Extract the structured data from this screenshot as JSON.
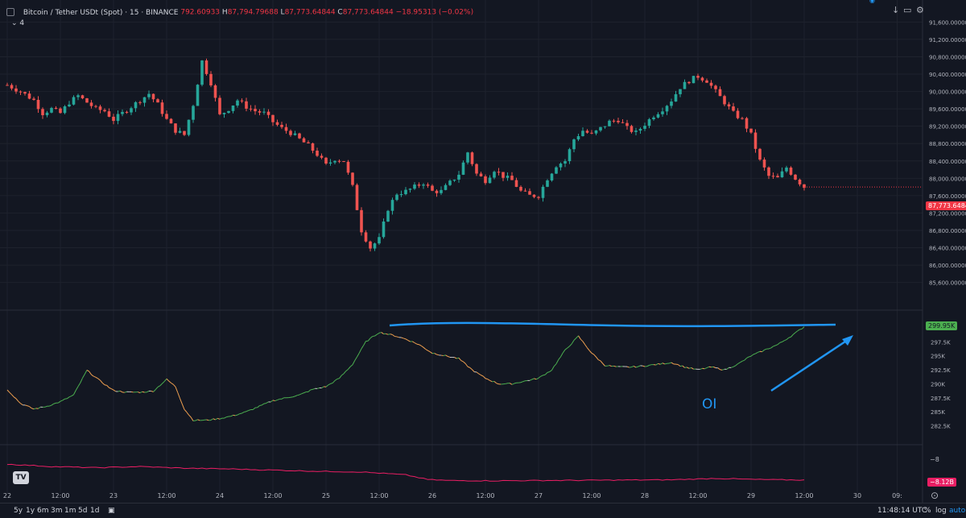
{
  "header": {
    "title": "Bitcoin / Tether USDt (Spot) · 15 · BINANCE",
    "o_value": "792.60933",
    "h_label": "H",
    "h_value": "87,794.79688",
    "l_label": "L",
    "l_value": "87,773.64844",
    "c_label": "C",
    "c_value": "87,773.64844",
    "change": "−18.95313 (−0.02%)",
    "sub_value": "4"
  },
  "price_badge": "87,773.64844",
  "oi_badge": "299.95K",
  "lower_badge": "−8.12B",
  "lower_tick": "−8",
  "annotation": "OI",
  "timeframes": [
    "5y",
    "1y",
    "6m",
    "3m",
    "1m",
    "5d",
    "1d"
  ],
  "bottom_right": {
    "time": "11:48:14 UTC",
    "percent": "%",
    "log": "log",
    "auto": "auto"
  },
  "chart_data": [
    {
      "type": "candlestick",
      "title": "Bitcoin / Tether USDt (Spot) · 15 · BINANCE",
      "ylim": [
        85500,
        91700
      ],
      "y_ticks": [
        "91,600.000000",
        "91,200.000000",
        "90,800.000000",
        "90,400.000000",
        "90,000.000000",
        "89,600.000000",
        "89,200.000000",
        "88,800.000000",
        "88,400.000000",
        "88,000.000000",
        "87,600.000000",
        "87,200.000000",
        "86,800.000000",
        "86,400.000000",
        "86,000.000000",
        "85,600.000000"
      ],
      "y_tick_values": [
        91600,
        91200,
        90800,
        90400,
        90000,
        89600,
        89200,
        88800,
        88400,
        88000,
        87600,
        87200,
        86800,
        86400,
        86000,
        85600
      ],
      "x_ticks": [
        "22",
        "12:00",
        "23",
        "12:00",
        "24",
        "12:00",
        "25",
        "12:00",
        "26",
        "12:00",
        "27",
        "12:00",
        "28",
        "12:00",
        "29",
        "12:00",
        "30",
        "09:"
      ],
      "x_tick_hours": [
        0,
        12,
        24,
        36,
        48,
        60,
        72,
        84,
        96,
        108,
        120,
        132,
        144,
        156,
        168,
        180,
        192,
        201
      ],
      "path_hours": [
        0,
        3,
        6,
        8,
        10,
        12,
        14,
        16,
        18,
        20,
        22,
        24,
        26,
        28,
        30,
        32,
        34,
        36,
        38,
        40,
        42,
        44,
        46,
        48,
        50,
        52,
        54,
        56,
        58,
        60,
        62,
        64,
        66,
        68,
        70,
        72,
        74,
        76,
        78,
        80,
        82,
        84,
        86,
        88,
        90,
        92,
        94,
        96,
        98,
        100,
        102,
        104,
        106,
        108,
        110,
        112,
        114,
        116,
        118,
        120,
        122,
        124,
        126,
        128,
        130,
        132,
        134,
        136,
        138,
        140,
        142,
        144,
        146,
        148,
        150,
        152,
        154,
        156,
        158,
        160,
        162,
        164,
        166,
        168,
        170,
        172,
        174,
        176,
        178,
        180
      ],
      "path_prices": [
        90150,
        90000,
        89800,
        89500,
        89600,
        89500,
        89750,
        89900,
        89750,
        89600,
        89550,
        89350,
        89500,
        89650,
        89800,
        89950,
        89700,
        89350,
        89100,
        89000,
        89700,
        90700,
        90200,
        89450,
        89600,
        89800,
        89650,
        89550,
        89500,
        89300,
        89150,
        89050,
        88900,
        88750,
        88550,
        88300,
        88450,
        88400,
        87800,
        86800,
        86400,
        86600,
        87300,
        87650,
        87700,
        87800,
        87900,
        87700,
        87700,
        87900,
        88100,
        88600,
        88100,
        87950,
        88200,
        88050,
        87950,
        87700,
        87600,
        87600,
        88000,
        88300,
        88400,
        88900,
        89100,
        89000,
        89150,
        89300,
        89350,
        89150,
        89050,
        89250,
        89450,
        89600,
        89800,
        90100,
        90250,
        90350,
        90250,
        90000,
        89750,
        89500,
        89350,
        89000,
        88400,
        88050,
        88000,
        88250,
        88000,
        87800
      ]
    },
    {
      "type": "line",
      "title": "",
      "ylim": [
        281000,
        301000
      ],
      "y_ticks": [
        "297.5K",
        "295K",
        "292.5K",
        "290K",
        "287.5K",
        "285K",
        "282.5K"
      ],
      "y_tick_values": [
        297500,
        295000,
        292500,
        290000,
        287500,
        285000,
        282500
      ],
      "x_hours": [
        0,
        3,
        6,
        9,
        12,
        15,
        18,
        21,
        24,
        27,
        30,
        33,
        36,
        38,
        40,
        42,
        45,
        48,
        51,
        54,
        57,
        60,
        63,
        66,
        69,
        72,
        75,
        78,
        81,
        84,
        87,
        90,
        93,
        96,
        99,
        102,
        105,
        108,
        111,
        114,
        117,
        120,
        123,
        126,
        129,
        132,
        135,
        138,
        141,
        144,
        147,
        150,
        153,
        156,
        159,
        162,
        165,
        168,
        171,
        174,
        177,
        180
      ],
      "values": [
        289000,
        286500,
        285500,
        286000,
        286800,
        288000,
        292400,
        290500,
        288800,
        288500,
        288500,
        288700,
        290800,
        289500,
        285500,
        283500,
        283500,
        283800,
        284300,
        285000,
        286000,
        287000,
        287500,
        288000,
        289000,
        289500,
        291000,
        293500,
        297500,
        299200,
        298700,
        298000,
        297000,
        295500,
        295000,
        294500,
        292500,
        291000,
        290000,
        290000,
        290500,
        291000,
        292500,
        296000,
        298500,
        295500,
        293300,
        293000,
        293000,
        293200,
        293500,
        293800,
        293000,
        292500,
        293000,
        292500,
        293500,
        295000,
        296000,
        297000,
        298500,
        300200
      ]
    },
    {
      "type": "line",
      "title": "",
      "ylim": [
        -8.6,
        -6.9
      ],
      "y_ticks": [
        "-8"
      ],
      "y_tick_values": [
        -8
      ],
      "x_hours": [
        0,
        10,
        20,
        30,
        40,
        50,
        60,
        70,
        80,
        90,
        95,
        100,
        110,
        120,
        130,
        140,
        150,
        160,
        170,
        180
      ],
      "values": [
        -7.45,
        -7.55,
        -7.6,
        -7.55,
        -7.62,
        -7.65,
        -7.7,
        -7.75,
        -7.78,
        -7.9,
        -8.1,
        -8.14,
        -8.15,
        -8.14,
        -8.13,
        -8.12,
        -8.11,
        -8.05,
        -8.1,
        -8.12
      ]
    }
  ]
}
